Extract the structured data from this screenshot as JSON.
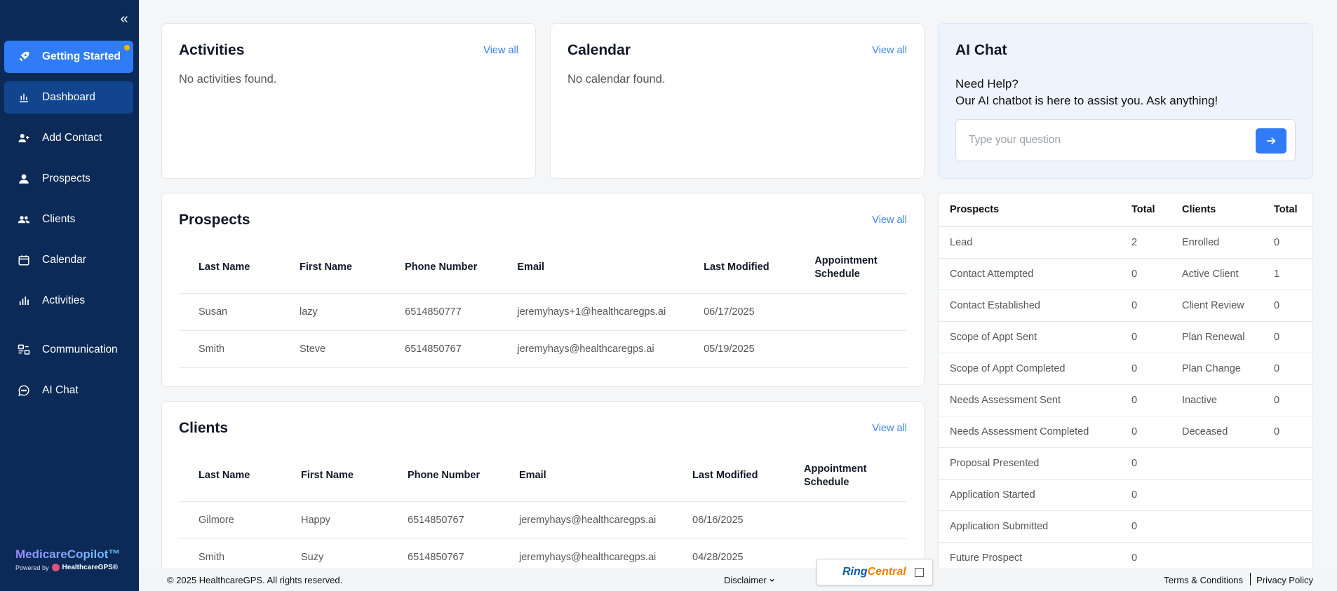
{
  "sidebar": {
    "items": [
      {
        "label": "Getting Started",
        "icon": "rocket-icon"
      },
      {
        "label": "Dashboard",
        "icon": "bar-chart-icon"
      },
      {
        "label": "Add Contact",
        "icon": "user-plus-icon"
      },
      {
        "label": "Prospects",
        "icon": "user-icon"
      },
      {
        "label": "Clients",
        "icon": "users-icon"
      },
      {
        "label": "Calendar",
        "icon": "calendar-icon"
      },
      {
        "label": "Activities",
        "icon": "activity-bars-icon"
      },
      {
        "label": "Communication",
        "icon": "communication-icon"
      },
      {
        "label": "AI Chat",
        "icon": "chat-bubble-icon"
      }
    ],
    "brand": {
      "name": "MedicareCopilot™",
      "powered_by": "Powered by",
      "company": "HealthcareGPS®"
    }
  },
  "activities": {
    "title": "Activities",
    "view_all": "View all",
    "empty": "No activities found."
  },
  "calendar": {
    "title": "Calendar",
    "view_all": "View all",
    "empty": "No calendar found."
  },
  "ai_chat": {
    "title": "AI Chat",
    "help_title": "Need Help?",
    "help_text": "Our AI chatbot is here to assist you. Ask anything!",
    "placeholder": "Type your question"
  },
  "prospects": {
    "title": "Prospects",
    "view_all": "View all",
    "columns": [
      "Last Name",
      "First Name",
      "Phone Number",
      "Email",
      "Last Modified",
      "Appointment Schedule"
    ],
    "rows": [
      [
        "Susan",
        "lazy",
        "6514850777",
        "jeremyhays+1@healthcaregps.ai",
        "06/17/2025",
        ""
      ],
      [
        "Smith",
        "Steve",
        "6514850767",
        "jeremyhays@healthcaregps.ai",
        "05/19/2025",
        ""
      ]
    ]
  },
  "clients": {
    "title": "Clients",
    "view_all": "View all",
    "columns": [
      "Last Name",
      "First Name",
      "Phone Number",
      "Email",
      "Last Modified",
      "Appointment Schedule"
    ],
    "rows": [
      [
        "Gilmore",
        "Happy",
        "6514850767",
        "jeremyhays@healthcaregps.ai",
        "06/16/2025",
        ""
      ],
      [
        "Smith",
        "Suzy",
        "6514850767",
        "jeremyhays@healthcaregps.ai",
        "04/28/2025",
        ""
      ]
    ]
  },
  "summary": {
    "headers": [
      "Prospects",
      "Total",
      "Clients",
      "Total"
    ],
    "rows": [
      [
        "Lead",
        "2",
        "Enrolled",
        "0"
      ],
      [
        "Contact Attempted",
        "0",
        "Active Client",
        "1"
      ],
      [
        "Contact Established",
        "0",
        "Client Review",
        "0"
      ],
      [
        "Scope of Appt Sent",
        "0",
        "Plan Renewal",
        "0"
      ],
      [
        "Scope of Appt Completed",
        "0",
        "Plan Change",
        "0"
      ],
      [
        "Needs Assessment Sent",
        "0",
        "Inactive",
        "0"
      ],
      [
        "Needs Assessment Completed",
        "0",
        "Deceased",
        "0"
      ],
      [
        "Proposal Presented",
        "0",
        "",
        ""
      ],
      [
        "Application Started",
        "0",
        "",
        ""
      ],
      [
        "Application Submitted",
        "0",
        "",
        ""
      ],
      [
        "Future Prospect",
        "0",
        "",
        ""
      ]
    ]
  },
  "footer": {
    "copyright": "© 2025 HealthcareGPS. All rights reserved.",
    "disclaimer": "Disclaimer",
    "terms": "Terms & Conditions",
    "privacy": "Privacy Policy"
  },
  "ringcentral": {
    "brand_a": "Ring",
    "brand_b": "Central"
  },
  "colors": {
    "sidebar": "#0b2a57",
    "accent": "#2f7cf6",
    "link": "#3b82f6"
  }
}
